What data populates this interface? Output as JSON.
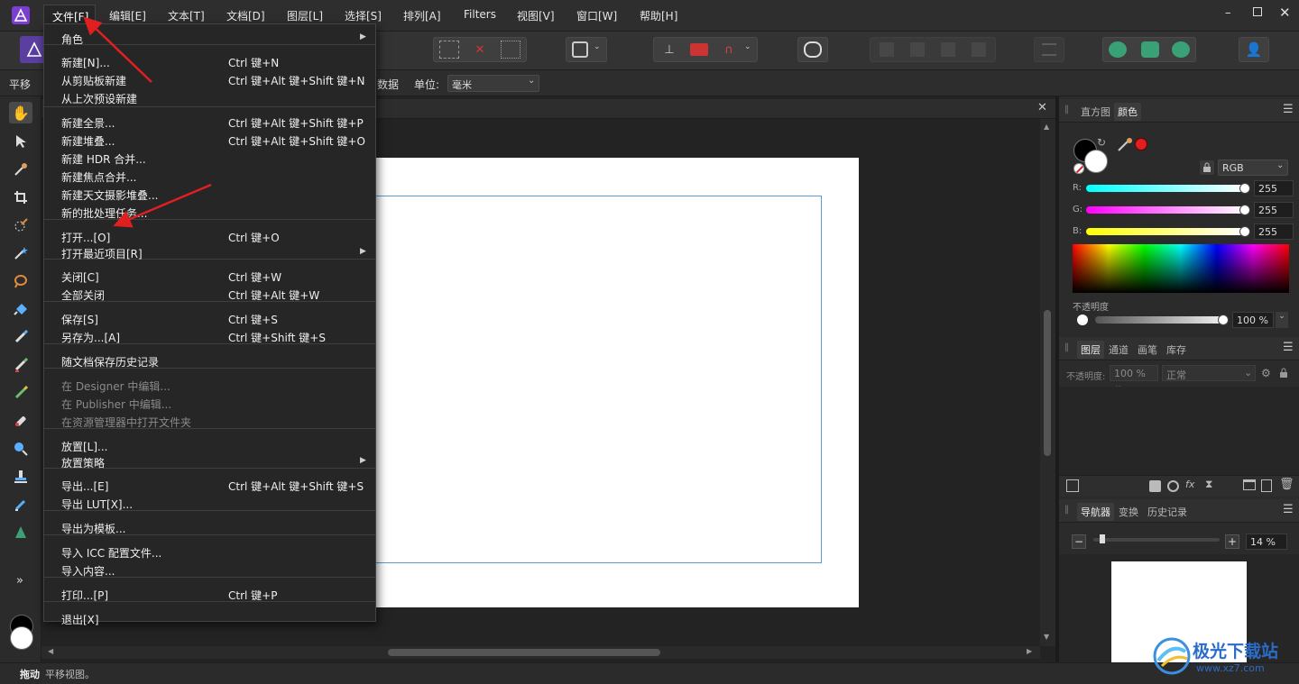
{
  "menubar": {
    "items": [
      "文件[F]",
      "编辑[E]",
      "文本[T]",
      "文档[D]",
      "图层[L]",
      "选择[S]",
      "排列[A]",
      "Filters",
      "视图[V]",
      "窗口[W]",
      "帮助[H]"
    ]
  },
  "context_bar": {
    "tool_name": "平移",
    "data_label": "数据",
    "unit_label": "单位:",
    "unit_value": "毫米"
  },
  "file_menu": {
    "items": [
      {
        "label": "角色",
        "shortcut": "",
        "submenu": true,
        "disabled": false
      },
      {
        "label": "新建[N]...",
        "shortcut": "Ctrl 键+N",
        "submenu": false,
        "disabled": false
      },
      {
        "label": "从剪贴板新建",
        "shortcut": "Ctrl 键+Alt 键+Shift 键+N",
        "submenu": false,
        "disabled": false
      },
      {
        "label": "从上次预设新建",
        "shortcut": "",
        "submenu": false,
        "disabled": false
      },
      {
        "label": "新建全景...",
        "shortcut": "Ctrl 键+Alt 键+Shift 键+P",
        "submenu": false,
        "disabled": false
      },
      {
        "label": "新建堆叠...",
        "shortcut": "Ctrl 键+Alt 键+Shift 键+O",
        "submenu": false,
        "disabled": false
      },
      {
        "label": "新建 HDR 合并...",
        "shortcut": "",
        "submenu": false,
        "disabled": false
      },
      {
        "label": "新建焦点合并...",
        "shortcut": "",
        "submenu": false,
        "disabled": false
      },
      {
        "label": "新建天文摄影堆叠...",
        "shortcut": "",
        "submenu": false,
        "disabled": false
      },
      {
        "label": "新的批处理任务...",
        "shortcut": "",
        "submenu": false,
        "disabled": false
      },
      {
        "label": "打开...[O]",
        "shortcut": "Ctrl 键+O",
        "submenu": false,
        "disabled": false
      },
      {
        "label": "打开最近项目[R]",
        "shortcut": "",
        "submenu": true,
        "disabled": false
      },
      {
        "label": "关闭[C]",
        "shortcut": "Ctrl 键+W",
        "submenu": false,
        "disabled": false
      },
      {
        "label": "全部关闭",
        "shortcut": "Ctrl 键+Alt 键+W",
        "submenu": false,
        "disabled": false
      },
      {
        "label": "保存[S]",
        "shortcut": "Ctrl 键+S",
        "submenu": false,
        "disabled": false
      },
      {
        "label": "另存为...[A]",
        "shortcut": "Ctrl 键+Shift 键+S",
        "submenu": false,
        "disabled": false
      },
      {
        "label": "随文档保存历史记录",
        "shortcut": "",
        "submenu": false,
        "disabled": false
      },
      {
        "label": "在 Designer 中编辑...",
        "shortcut": "",
        "submenu": false,
        "disabled": true
      },
      {
        "label": "在 Publisher 中编辑...",
        "shortcut": "",
        "submenu": false,
        "disabled": true
      },
      {
        "label": "在资源管理器中打开文件夹",
        "shortcut": "",
        "submenu": false,
        "disabled": true
      },
      {
        "label": "放置[L]...",
        "shortcut": "",
        "submenu": false,
        "disabled": false
      },
      {
        "label": "放置策略",
        "shortcut": "",
        "submenu": true,
        "disabled": false
      },
      {
        "label": "导出...[E]",
        "shortcut": "Ctrl 键+Alt 键+Shift 键+S",
        "submenu": false,
        "disabled": false
      },
      {
        "label": "导出 LUT[X]...",
        "shortcut": "",
        "submenu": false,
        "disabled": false
      },
      {
        "label": "导出为模板...",
        "shortcut": "",
        "submenu": false,
        "disabled": false
      },
      {
        "label": "导入 ICC 配置文件...",
        "shortcut": "",
        "submenu": false,
        "disabled": false
      },
      {
        "label": "导入内容...",
        "shortcut": "",
        "submenu": false,
        "disabled": false
      },
      {
        "label": "打印...[P]",
        "shortcut": "Ctrl 键+P",
        "submenu": false,
        "disabled": false
      },
      {
        "label": "退出[X]",
        "shortcut": "",
        "submenu": false,
        "disabled": false
      }
    ]
  },
  "color_panel": {
    "tabs": [
      "直方图",
      "颜色"
    ],
    "active_tab": "颜色",
    "mode": "RGB",
    "r_label": "R:",
    "r_value": "255",
    "g_label": "G:",
    "g_value": "255",
    "b_label": "B:",
    "b_value": "255",
    "opacity_label": "不透明度",
    "opacity_value": "100 %"
  },
  "layers_panel": {
    "tabs": [
      "图层",
      "通道",
      "画笔",
      "库存"
    ],
    "active_tab": "图层",
    "opacity_label": "不透明度:",
    "opacity_value": "100 %",
    "blend_mode": "正常"
  },
  "navigator_panel": {
    "tabs": [
      "导航器",
      "变换",
      "历史记录"
    ],
    "active_tab": "导航器",
    "zoom_value": "14 %"
  },
  "statusbar": {
    "action": "拖动",
    "message": "平移视图。"
  },
  "watermark": {
    "brand": "极光下载站",
    "url": "www.xz7.com"
  },
  "colors": {
    "accent_red": "#e02020",
    "app_purple": "#8a4fd6",
    "guide_blue": "#5a9bd4"
  }
}
